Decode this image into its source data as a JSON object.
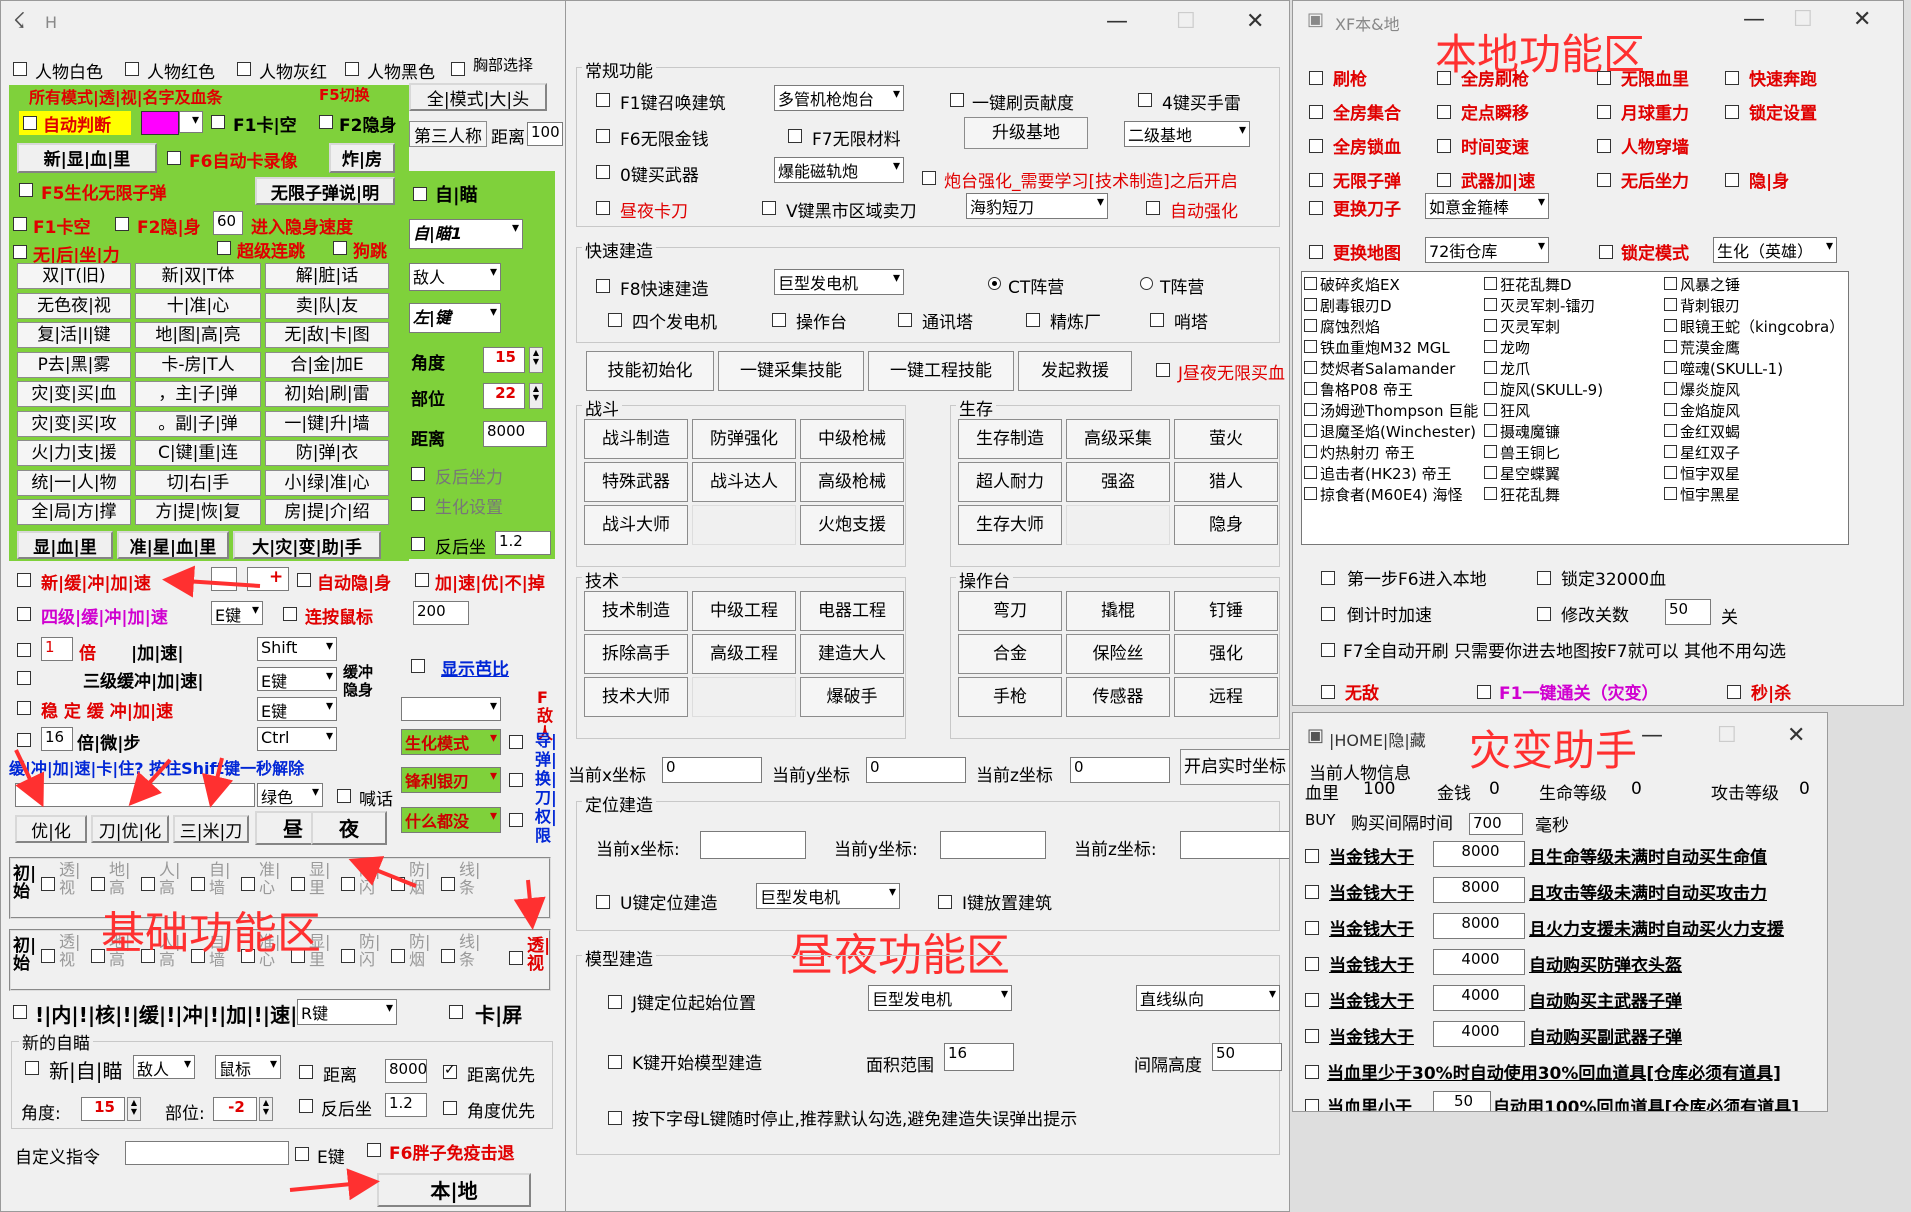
{
  "w1": {
    "title": "H",
    "row1": [
      "人物白色",
      "人物红色",
      "人物灰红",
      "人物黑色",
      "胸部选择"
    ],
    "header_green": "所有模式|透|视|名字及血条",
    "f5switch": "F5切换",
    "btn_all_mode": "全|模式|大|头",
    "btn_third": "第三人称",
    "dist_lbl": "距离",
    "dist_val": "100",
    "auto_judge": "自动判断",
    "f1kakong": "F1卡|空",
    "f2yinshen": "F2隐身",
    "btn_new_blood": "新|显|血|里",
    "f6auto": "F6自动卡录像",
    "btn_zhafang": "炸|房",
    "f5shenghua": "F5生化无限子弹",
    "btn_inf_ammo": "无限子弹说|明",
    "f1kakong2": "F1卡空",
    "f2yinshen2": "F2隐|身",
    "speed_val": "60",
    "speed_lbl": "进入隐身速度",
    "no_recoil": "无|后|坐|力",
    "super_link": "超级连跳",
    "gouzhao": "狗跳",
    "green_buttons": [
      "双|T(旧)",
      "新|双|T体",
      "解|脏|话",
      "无色夜|视",
      "十|准|心",
      "卖|队|友",
      "复|活|I|键",
      "地|图|高|亮",
      "无|敌|卡|图",
      "P去|黑|雾",
      "卡-房|T人",
      "合|金|加E",
      "灾|变|买|血",
      "，主|子|弹",
      "初|始|刷|雷",
      "灾|变|买|攻",
      "。副|子|弹",
      "一|键|升|墙",
      "火|力|支|援",
      "C|键|重|连",
      "防|弹|衣",
      "统|一|人|物",
      "切|右|手",
      "小|绿|准|心",
      "全|局|方|撑",
      "方|提|恢|复",
      "房|提|介|绍"
    ],
    "show_bar": [
      "显|血|里",
      "准|星|血|里",
      "大|灾|变|助|手"
    ],
    "new_buffer": "新|缓|冲|加|速",
    "auto_hide": "自动隐|身",
    "speed_first": "加|速|优|不|掉",
    "level4": "四级|缓|冲|加|速",
    "sel_e": "E键",
    "link_mouse": "连按鼠标",
    "val_200": "200",
    "val_1": "1",
    "bei": "倍",
    "jiasu_lbl": "|加|速|",
    "shift": "Shift",
    "level3": "三级缓冲|加|速|",
    "e_key": "E键",
    "buffer_hide": "缓冲隐身",
    "stable": "稳 定 缓 冲|加|速",
    "val_16": "16",
    "micro": "倍|微|步",
    "ctrl": "Ctrl",
    "show_ratio": "显示芭比",
    "f_cat": "F敌人",
    "hint_blue": "缓|冲|加|速|卡|住? 按住Shift键一秒解除",
    "green_sel": "绿色",
    "shout": "喊话",
    "btn_opt": "优|化",
    "btn_knife": "刀|优|化",
    "btn_3m": "三|米|刀",
    "btn_day": "昼",
    "btn_night": "夜",
    "row_chk": [
      "透|视",
      "地|高",
      "人|高",
      "自|墙",
      "准|心",
      "显|里",
      "防|闪",
      "防|烟",
      "线|条"
    ],
    "chushi": "初|始",
    "touzhi": "透|视",
    "zone_basic": "基础功能区",
    "bottom_speed": "!|内|!|核|!|缓|!|冲|!|加|!|速|!",
    "r_key": "R键",
    "kaping": "卡|屏",
    "new_aim_group": "新的自瞄",
    "new_aim": "新|自|瞄",
    "enemy": "敌人",
    "mouse": "鼠标",
    "distance": "距离",
    "dist2": "8000",
    "dist_first": "距离优先",
    "angle": "角度:",
    "angle_v": "15",
    "part": "部位:",
    "part_v": "-2",
    "recoil": "反后坐",
    "recoil_v": "1.2",
    "angle_first": "角度优先",
    "custom_cmd": "自定义指令",
    "e_key2": "E键",
    "f6_fat": "F6胖子免疫击退",
    "btn_local": "本|地",
    "aim_self": "自|瞄",
    "aim1": "自|瞄1",
    "enemy2": "敌人",
    "left_key": "左|键",
    "angle2": "角度",
    "angle2_v": "15",
    "part2": "部位",
    "part2_v": "22",
    "dist3": "距离",
    "dist3_v": "8000",
    "anti_recoil": "反后坐力",
    "bio_set": "生化设置",
    "recoil2": "反后坐",
    "recoil2_v": "1.2",
    "bio_mode": "生化模式",
    "sharp_knife": "锋利银刃",
    "what_stupid": "什么都没",
    "vert_text": "导|弹|换|刀|权|限"
  },
  "w2": {
    "grp_normal": "常规功能",
    "f1call": "F1键召唤建筑",
    "sel_guns": "多管机枪炮台",
    "one_contrib": "一键刷贡献度",
    "k4": "4键买手雷",
    "f6inf": "F6无限金钱",
    "f7mat": "F7无限材料",
    "btn_upgrade": "升级基地",
    "sel_level2": "二级基地",
    "buy0": "0键买武器",
    "sel_rail": "爆能磁轨炮",
    "turret_hint": "炮台强化_需要学习[技术制造]之后开启",
    "day_knife": "昼夜卡刀",
    "v_black": "V键黑市区域卖刀",
    "sel_leopard": "海豹短刀",
    "auto_boost": "自动强化",
    "grp_build": "快速建造",
    "f8": "F8快速建造",
    "sel_gen": "巨型发电机",
    "ct": "CT阵营",
    "t": "T阵营",
    "four_gen": "四个发电机",
    "console": "操作台",
    "tower": "通讯塔",
    "refine": "精炼厂",
    "watch": "哨塔",
    "btn_skill_init": "技能初始化",
    "btn_collect": "一键采集技能",
    "btn_eng": "一键工程技能",
    "btn_rescue": "发起救援",
    "j_day": "J昼夜无限买血",
    "grp_fight": "战斗",
    "fight_btns": [
      "战斗制造",
      "防弹强化",
      "中级枪械",
      "特殊武器",
      "战斗达人",
      "高级枪械",
      "战斗大师",
      "",
      "火炮支援"
    ],
    "grp_survive": "生存",
    "survive_btns": [
      "生存制造",
      "高级采集",
      "萤火",
      "超人耐力",
      "强盗",
      "猎人",
      "生存大师",
      "",
      "隐身"
    ],
    "grp_tech": "技术",
    "tech_btns": [
      "技术制造",
      "中级工程",
      "电器工程",
      "拆除高手",
      "高级工程",
      "建造大人",
      "技术大师",
      "",
      "爆破手"
    ],
    "grp_console": "操作台",
    "console_btns": [
      "弯刀",
      "撬棍",
      "钉锤",
      "合金",
      "保险丝",
      "强化",
      "手枪",
      "传感器",
      "远程"
    ],
    "cur_x": "当前x坐标",
    "cur_x_v": "0",
    "cur_y": "当前y坐标",
    "cur_y_v": "0",
    "cur_z": "当前z坐标",
    "cur_z_v": "0",
    "btn_realtime": "开启实时坐标",
    "grp_pos": "定位建造",
    "cur_x2": "当前x坐标:",
    "cur_y2": "当前y坐标:",
    "cur_z2": "当前z坐标:",
    "u_pos": "U键定位建造",
    "sel_gen2": "巨型发电机",
    "i_place": "I键放置建筑",
    "zone_day": "昼夜功能区",
    "grp_model": "模型建造",
    "j_start": "J键定位起始位置",
    "sel_gen3": "巨型发电机",
    "sel_line": "直线纵向",
    "k_start": "K键开始模型建造",
    "area": "面积范围",
    "area_v": "16",
    "gap": "间隔高度",
    "gap_v": "50",
    "l_hint": "按下字母L键随时停止,推荐默认勾选,避免建造失误弹出提示"
  },
  "w3": {
    "title": "XF本&地",
    "zone": "本地功能区",
    "rows": [
      [
        "刷枪",
        "全房刷枪",
        "无限血里",
        "快速奔跑"
      ],
      [
        "全房集合",
        "定点瞬移",
        "月球重力",
        "锁定设置"
      ],
      [
        "全房锁血",
        "时间变速",
        "人物穿墙",
        ""
      ],
      [
        "无限子弹",
        "武器加|速",
        "无后坐力",
        "隐|身"
      ]
    ],
    "change_knife": "更换刀子",
    "sel_knife": "如意金箍棒",
    "change_map": "更换地图",
    "sel_map": "72街仓库",
    "lock_mode": "锁定模式",
    "sel_mode": "生化（英雄）",
    "col1": [
      "破碎炙焰EX",
      "剧毒银刃D",
      "腐蚀烈焰",
      "铁血重炮M32 MGL",
      "焚烬者Salamander",
      "鲁格P08 帝王",
      "汤姆逊Thompson 巨能",
      "退魔圣焰(Winchester)",
      "灼热射刃 帝王",
      "追击者(HK23) 帝王",
      "掠食者(M60E4) 海怪"
    ],
    "col2": [
      "狂花乱舞D",
      "灭灵军刺-镭刃",
      "灭灵军刺",
      "龙吻",
      "龙爪",
      "旋风(SKULL-9)",
      "狂风",
      "摄魂魔镰",
      "兽王铜匕",
      "星空蝶翼",
      "狂花乱舞"
    ],
    "col3": [
      "风暴之锤",
      "背刺银刃",
      "眼镜王蛇（kingcobra）",
      "荒漠金鹰",
      "噬魂(SKULL-1)",
      "爆炎旋风",
      "金焰旋风",
      "金红双蝎",
      "星红双子",
      "恒宇双星",
      "恒宇黑星"
    ],
    "f6_enter": "第一步F6进入本地",
    "lock32": "锁定32000血",
    "countdown": "倒计时加速",
    "modify": "修改关数",
    "level_v": "50",
    "guan": "关",
    "f7": "F7全自动开刷 只需要你进去地图按F7就可以 其他不用勾选",
    "wudi": "无敌",
    "f1_pass": "F1一键通关（灾变）",
    "miaosha": "秒|杀"
  },
  "w4": {
    "title": "|HOME|隐|藏",
    "zone": "灾变助手",
    "info": "当前人物信息",
    "blood": "血里",
    "blood_v": "100",
    "money": "金钱",
    "money_v": "0",
    "life": "生命等级",
    "life_v": "0",
    "atk": "攻击等级",
    "atk_v": "0",
    "buy": "BUY",
    "buy_gap": "购买间隔时间",
    "buy_gap_v": "700",
    "ms": "毫秒",
    "rows": [
      {
        "pre": "当金钱大于",
        "val": "8000",
        "desc": "且生命等级未满时自动买生命值"
      },
      {
        "pre": "当金钱大于",
        "val": "8000",
        "desc": "且攻击等级未满时自动买攻击力"
      },
      {
        "pre": "当金钱大于",
        "val": "8000",
        "desc": "且火力支援未满时自动买火力支援"
      },
      {
        "pre": "当金钱大于",
        "val": "4000",
        "desc": "自动购买防弹衣头盔"
      },
      {
        "pre": "当金钱大于",
        "val": "4000",
        "desc": "自动购买主武器子弹"
      },
      {
        "pre": "当金钱大于",
        "val": "4000",
        "desc": "自动购买副武器子弹"
      }
    ],
    "low30": "当血里少于30%时自动使用30%回血道具[仓库必须有道具]",
    "low_pre": "当血里小于",
    "low_v": "50",
    "low_desc": "自动用100%回血道具[仓库必须有道具]"
  }
}
